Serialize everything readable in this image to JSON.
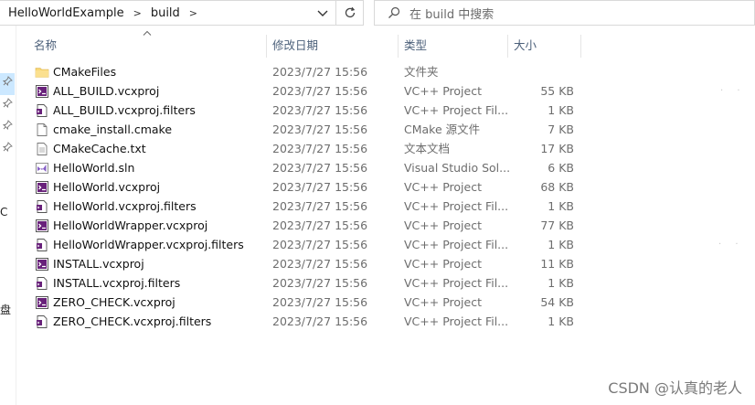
{
  "address": {
    "crumbs": [
      "HelloWorldExample",
      "build"
    ],
    "separator": ">"
  },
  "search": {
    "placeholder": "在 build 中搜索"
  },
  "nav_letters": [
    "C",
    "盘"
  ],
  "columns": {
    "name": "名称",
    "date": "修改日期",
    "type": "类型",
    "size": "大小"
  },
  "files": [
    {
      "name": "CMakeFiles",
      "date": "2023/7/27 15:56",
      "type": "文件夹",
      "size": "",
      "icon": "folder-icon"
    },
    {
      "name": "ALL_BUILD.vcxproj",
      "date": "2023/7/27 15:56",
      "type": "VC++ Project",
      "size": "55 KB",
      "icon": "vcxproj-icon"
    },
    {
      "name": "ALL_BUILD.vcxproj.filters",
      "date": "2023/7/27 15:56",
      "type": "VC++ Project Fil...",
      "size": "1 KB",
      "icon": "vcxproj-filters-icon"
    },
    {
      "name": "cmake_install.cmake",
      "date": "2023/7/27 15:56",
      "type": "CMake 源文件",
      "size": "7 KB",
      "icon": "document-icon"
    },
    {
      "name": "CMakeCache.txt",
      "date": "2023/7/27 15:56",
      "type": "文本文档",
      "size": "17 KB",
      "icon": "text-document-icon"
    },
    {
      "name": "HelloWorld.sln",
      "date": "2023/7/27 15:56",
      "type": "Visual Studio Sol...",
      "size": "6 KB",
      "icon": "visual-studio-solution-icon"
    },
    {
      "name": "HelloWorld.vcxproj",
      "date": "2023/7/27 15:56",
      "type": "VC++ Project",
      "size": "68 KB",
      "icon": "vcxproj-icon"
    },
    {
      "name": "HelloWorld.vcxproj.filters",
      "date": "2023/7/27 15:56",
      "type": "VC++ Project Fil...",
      "size": "1 KB",
      "icon": "vcxproj-filters-icon"
    },
    {
      "name": "HelloWorldWrapper.vcxproj",
      "date": "2023/7/27 15:56",
      "type": "VC++ Project",
      "size": "77 KB",
      "icon": "vcxproj-icon"
    },
    {
      "name": "HelloWorldWrapper.vcxproj.filters",
      "date": "2023/7/27 15:56",
      "type": "VC++ Project Fil...",
      "size": "1 KB",
      "icon": "vcxproj-filters-icon"
    },
    {
      "name": "INSTALL.vcxproj",
      "date": "2023/7/27 15:56",
      "type": "VC++ Project",
      "size": "11 KB",
      "icon": "vcxproj-icon"
    },
    {
      "name": "INSTALL.vcxproj.filters",
      "date": "2023/7/27 15:56",
      "type": "VC++ Project Fil...",
      "size": "1 KB",
      "icon": "vcxproj-filters-icon"
    },
    {
      "name": "ZERO_CHECK.vcxproj",
      "date": "2023/7/27 15:56",
      "type": "VC++ Project",
      "size": "54 KB",
      "icon": "vcxproj-icon"
    },
    {
      "name": "ZERO_CHECK.vcxproj.filters",
      "date": "2023/7/27 15:56",
      "type": "VC++ Project Fil...",
      "size": "1 KB",
      "icon": "vcxproj-filters-icon"
    }
  ],
  "watermark": "CSDN @认真的老人",
  "colors": {
    "selection": "#cce8ff",
    "header_text": "#4c607a",
    "folder": "#f8d775",
    "vcx_purple": "#68217a"
  }
}
